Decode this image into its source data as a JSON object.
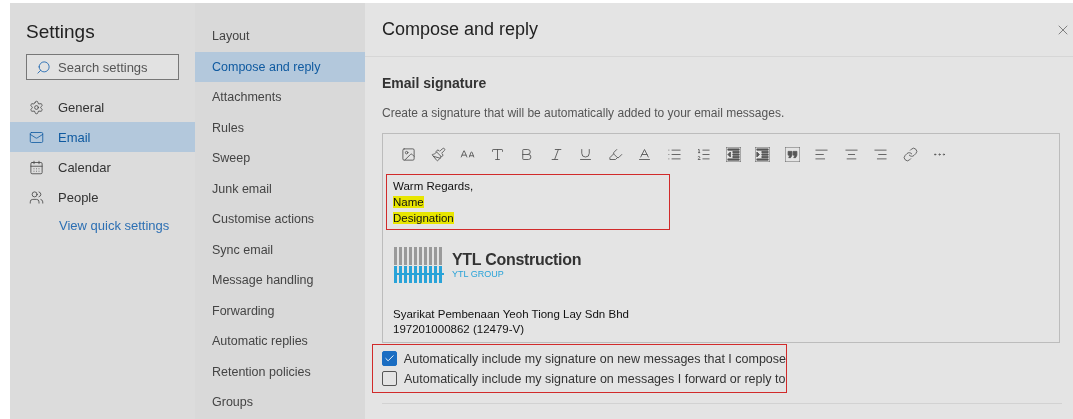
{
  "settings": {
    "title": "Settings",
    "search": {
      "placeholder": "Search settings"
    },
    "categories": [
      {
        "label": "General",
        "selected": false
      },
      {
        "label": "Email",
        "selected": true
      },
      {
        "label": "Calendar",
        "selected": false
      },
      {
        "label": "People",
        "selected": false
      }
    ],
    "quick_link": "View quick settings"
  },
  "subnav": {
    "items": [
      {
        "label": "Layout",
        "selected": false
      },
      {
        "label": "Compose and reply",
        "selected": true
      },
      {
        "label": "Attachments",
        "selected": false
      },
      {
        "label": "Rules",
        "selected": false
      },
      {
        "label": "Sweep",
        "selected": false
      },
      {
        "label": "Junk email",
        "selected": false
      },
      {
        "label": "Customise actions",
        "selected": false
      },
      {
        "label": "Sync email",
        "selected": false
      },
      {
        "label": "Message handling",
        "selected": false
      },
      {
        "label": "Forwarding",
        "selected": false
      },
      {
        "label": "Automatic replies",
        "selected": false
      },
      {
        "label": "Retention policies",
        "selected": false
      },
      {
        "label": "Groups",
        "selected": false
      }
    ]
  },
  "panel": {
    "title": "Compose and reply",
    "section": "Email signature",
    "description": "Create a signature that will be automatically added to your email messages.",
    "signature": {
      "lines": [
        {
          "text": "Warm Regards,",
          "highlighted": false
        },
        {
          "text": "Name",
          "highlighted": true
        },
        {
          "text": "Designation",
          "highlighted": true
        }
      ],
      "company": "YTL Construction",
      "group": "YTL GROUP",
      "legal_lines": [
        "Syarikat Pembenaan Yeoh Tiong Lay Sdn Bhd",
        "197201000862 (12479-V)"
      ]
    },
    "options": [
      {
        "label": "Automatically include my signature on new messages that I compose",
        "checked": true
      },
      {
        "label": "Automatically include my signature on messages I forward or reply to",
        "checked": false
      }
    ]
  }
}
